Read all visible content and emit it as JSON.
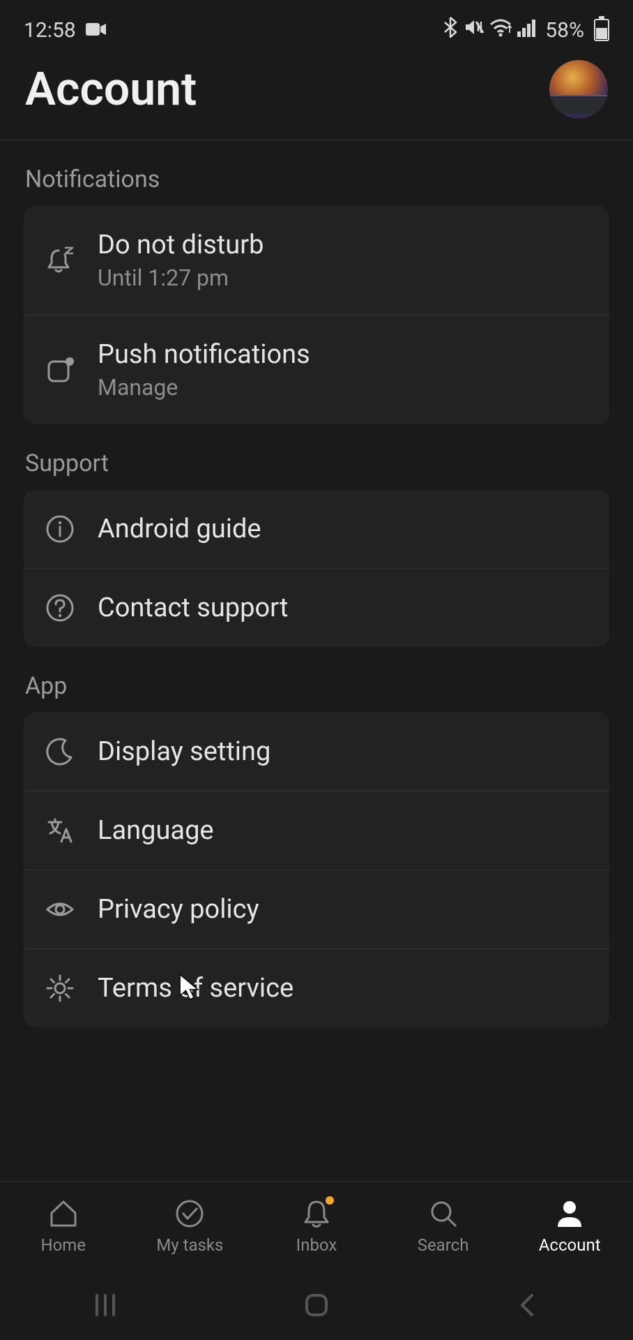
{
  "status": {
    "time": "12:58",
    "battery_pct": "58%"
  },
  "header": {
    "title": "Account"
  },
  "sections": {
    "notifications": {
      "title": "Notifications",
      "dnd": {
        "title": "Do not disturb",
        "sub": "Until 1:27 pm"
      },
      "push": {
        "title": "Push notifications",
        "sub": "Manage"
      }
    },
    "support": {
      "title": "Support",
      "guide": {
        "title": "Android guide"
      },
      "contact": {
        "title": "Contact support"
      }
    },
    "app": {
      "title": "App",
      "display": {
        "title": "Display setting"
      },
      "language": {
        "title": "Language"
      },
      "privacy": {
        "title": "Privacy policy"
      },
      "terms": {
        "title": "Terms of service"
      }
    }
  },
  "nav": {
    "home": "Home",
    "mytasks": "My tasks",
    "inbox": "Inbox",
    "search": "Search",
    "account": "Account"
  }
}
